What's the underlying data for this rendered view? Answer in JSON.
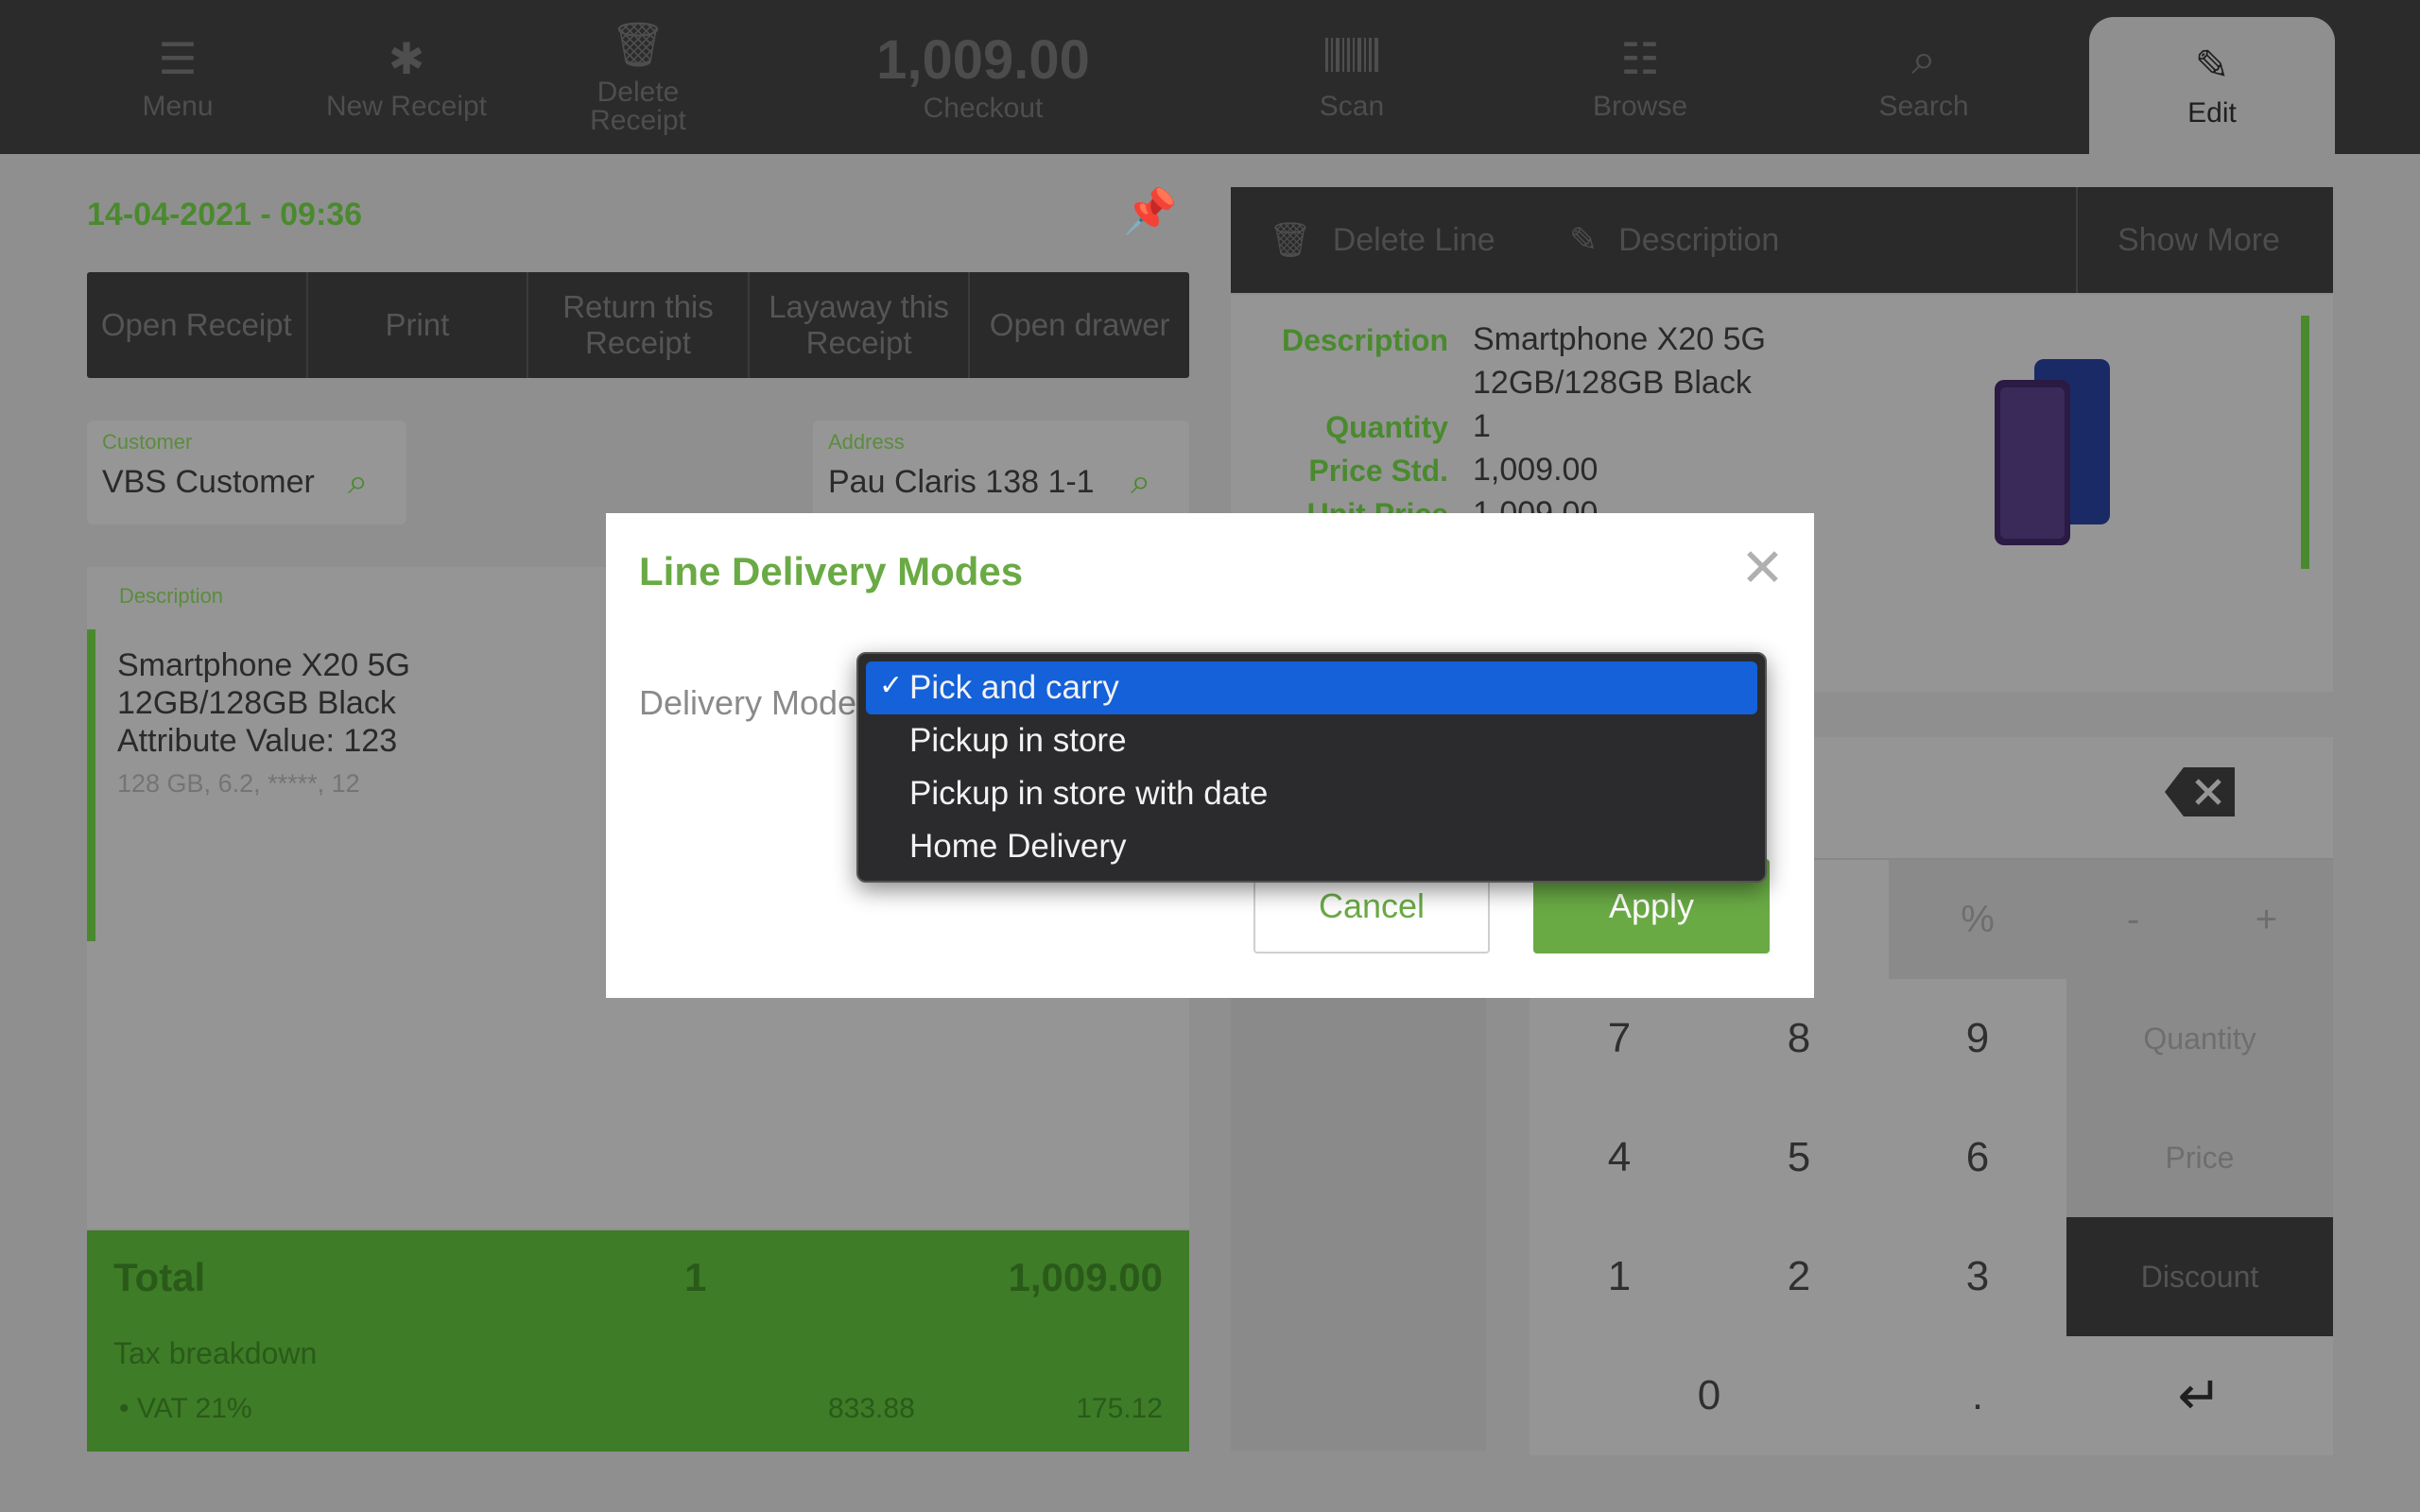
{
  "topbar": {
    "menu": "Menu",
    "new_receipt": "New Receipt",
    "delete_receipt": "Delete Receipt",
    "checkout_total": "1,009.00",
    "checkout": "Checkout",
    "scan": "Scan",
    "browse": "Browse",
    "search": "Search",
    "edit": "Edit"
  },
  "receipt_header": {
    "datetime": "14-04-2021 - 09:36"
  },
  "receipt_actions": [
    "Open Receipt",
    "Print",
    "Return this Receipt",
    "Layaway this Receipt",
    "Open drawer"
  ],
  "customer": {
    "caption": "Customer",
    "value": "VBS Customer"
  },
  "address": {
    "caption": "Address",
    "value": "Pau Claris 138 1-1"
  },
  "receipt": {
    "caption": "Description",
    "item_name": "Smartphone X20 5G 12GB/128GB Black",
    "item_attribute": "Attribute Value: 123",
    "item_details": "128 GB, 6.2, *****, 12"
  },
  "totals": {
    "label": "Total",
    "qty": "1",
    "amount": "1,009.00",
    "tax_breakdown": "Tax breakdown",
    "vat_label": "VAT 21%",
    "vat_base": "833.88",
    "vat_amount": "175.12"
  },
  "line_actions": {
    "delete_line": "Delete Line",
    "description": "Description",
    "show_more": "Show More"
  },
  "line_details": {
    "description_key": "Description",
    "description_val_1": "Smartphone X20 5G",
    "description_val_2": "12GB/128GB Black",
    "quantity_key": "Quantity",
    "quantity_val": "1",
    "price_std_key": "Price Std.",
    "price_std_val": "1,009.00",
    "unit_price_key": "Unit Price",
    "unit_price_val": "1,009.00"
  },
  "keypad": {
    "ops": [
      "%",
      "-",
      "+"
    ],
    "digits": [
      "7",
      "8",
      "9",
      "4",
      "5",
      "6",
      "1",
      "2",
      "3",
      "0",
      "."
    ],
    "quantity": "Quantity",
    "price": "Price",
    "discount": "Discount",
    "enter": "↵"
  },
  "modal": {
    "title": "Line Delivery Modes",
    "close": "✕",
    "delivery_mode_label": "Delivery Mode",
    "cancel": "Cancel",
    "apply": "Apply"
  },
  "dropdown": {
    "options": [
      "Pick and carry",
      "Pickup in store",
      "Pickup in store with date",
      "Home Delivery"
    ],
    "selected": "Pick and carry",
    "check": "✓"
  },
  "colors": {
    "accent_green": "#6aaa45",
    "selection_blue": "#1461d9",
    "topbar": "#2b2b2b"
  }
}
